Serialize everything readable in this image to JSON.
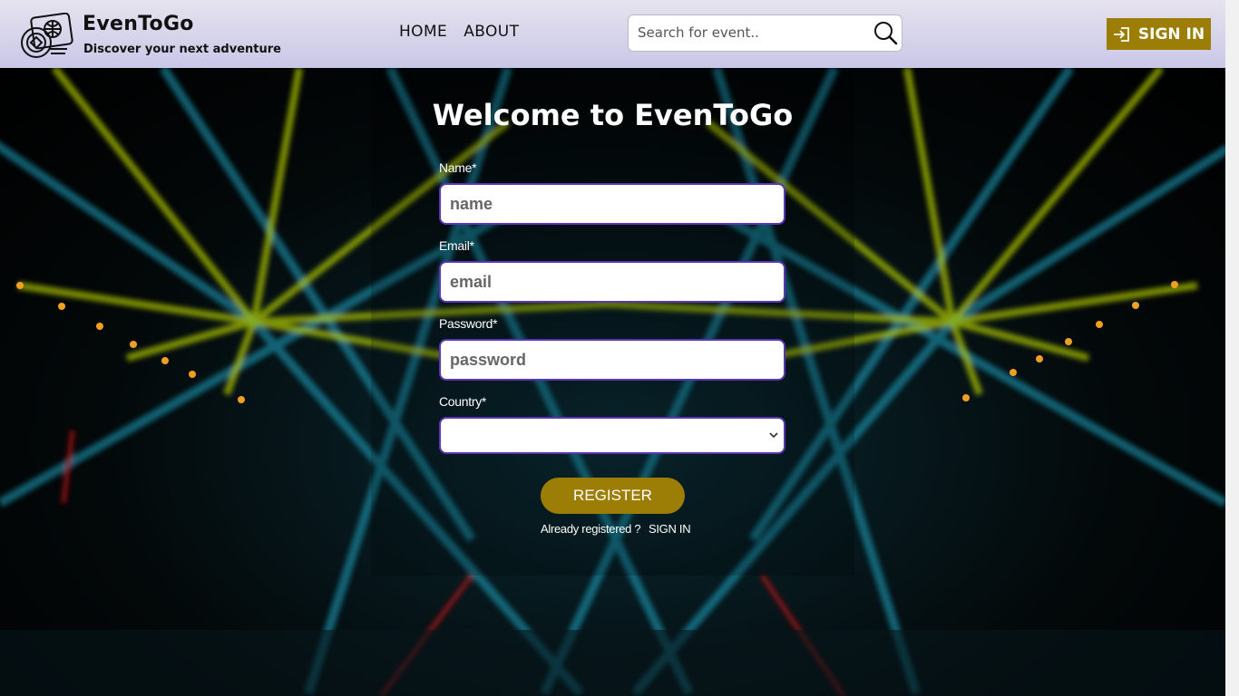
{
  "header": {
    "brand": "EvenToGo",
    "tagline": "Discover your next adventure",
    "nav": [
      {
        "label": "HOME"
      },
      {
        "label": "ABOUT"
      }
    ],
    "search": {
      "placeholder": "Search for event..",
      "value": ""
    },
    "signin_label": "SIGN IN"
  },
  "form": {
    "title": "Welcome to EvenToGo",
    "fields": [
      {
        "label": "Name*",
        "placeholder": "name",
        "value": ""
      },
      {
        "label": "Email*",
        "placeholder": "email",
        "value": ""
      },
      {
        "label": "Password*",
        "placeholder": "password",
        "value": ""
      },
      {
        "label": "Country*",
        "selected": ""
      }
    ],
    "register_label": "REGISTER",
    "already_text": "Already registered ?",
    "signin_link": "SIGN IN"
  },
  "colors": {
    "accent": "#9c7d05",
    "field_border": "#5a35b8",
    "header_bg": "#d6d4ec"
  },
  "icons": [
    "logo-passport-globe-icon",
    "search-icon",
    "sign-in-icon",
    "chevron-down-icon"
  ]
}
